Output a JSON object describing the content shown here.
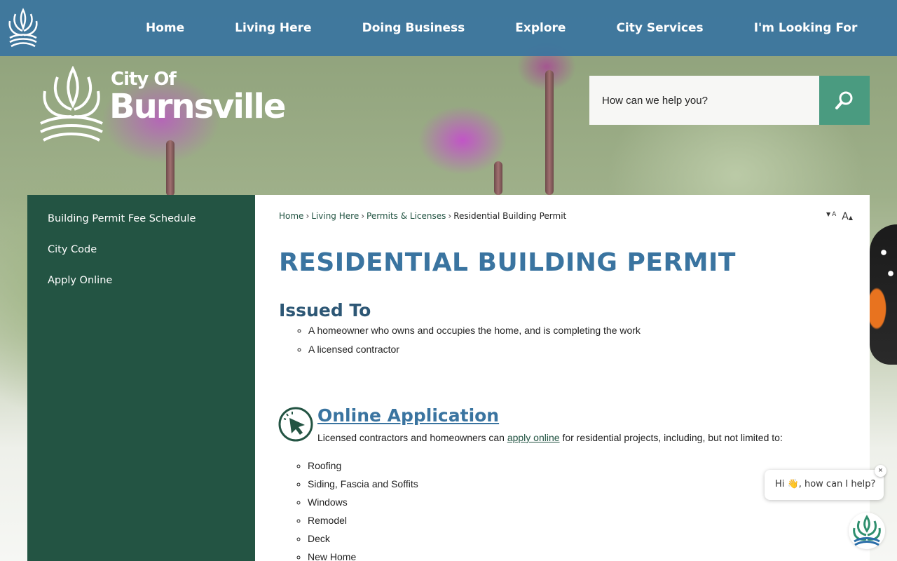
{
  "nav": {
    "items": [
      {
        "label": "Home"
      },
      {
        "label": "Living Here"
      },
      {
        "label": "Doing Business"
      },
      {
        "label": "Explore"
      },
      {
        "label": "City Services"
      },
      {
        "label": "I'm Looking For"
      }
    ]
  },
  "logo": {
    "line1": "City Of",
    "line2": "Burnsville"
  },
  "search": {
    "placeholder": "How can we help you?"
  },
  "sidebar": {
    "items": [
      {
        "label": "Building Permit Fee Schedule"
      },
      {
        "label": "City Code"
      },
      {
        "label": "Apply Online"
      }
    ]
  },
  "breadcrumb": {
    "home": "Home",
    "living": "Living Here",
    "permits": "Permits & Licenses",
    "current": "Residential Building Permit"
  },
  "fontsize": {
    "decrease": "A",
    "increase": "A"
  },
  "page": {
    "title": "RESIDENTIAL BUILDING PERMIT",
    "issued_heading": "Issued To",
    "issued_items": [
      "A homeowner who owns and occupies the home, and is completing the work",
      "A licensed contractor"
    ],
    "app_heading": "Online Application",
    "app_text_before": "Licensed contractors and homeowners can ",
    "app_link": "apply online",
    "app_text_after": " for residential projects, including, but not limited to:",
    "projects": [
      "Roofing",
      "Siding, Fascia and Soffits",
      "Windows",
      "Remodel",
      "Deck",
      "New Home"
    ]
  },
  "chat": {
    "greeting": "Hi 👋, how can I help?",
    "close": "×"
  },
  "colors": {
    "nav": "#3a74a0",
    "sidebar": "#235443",
    "search_button": "#4a9b80",
    "title": "#3a74a0"
  }
}
